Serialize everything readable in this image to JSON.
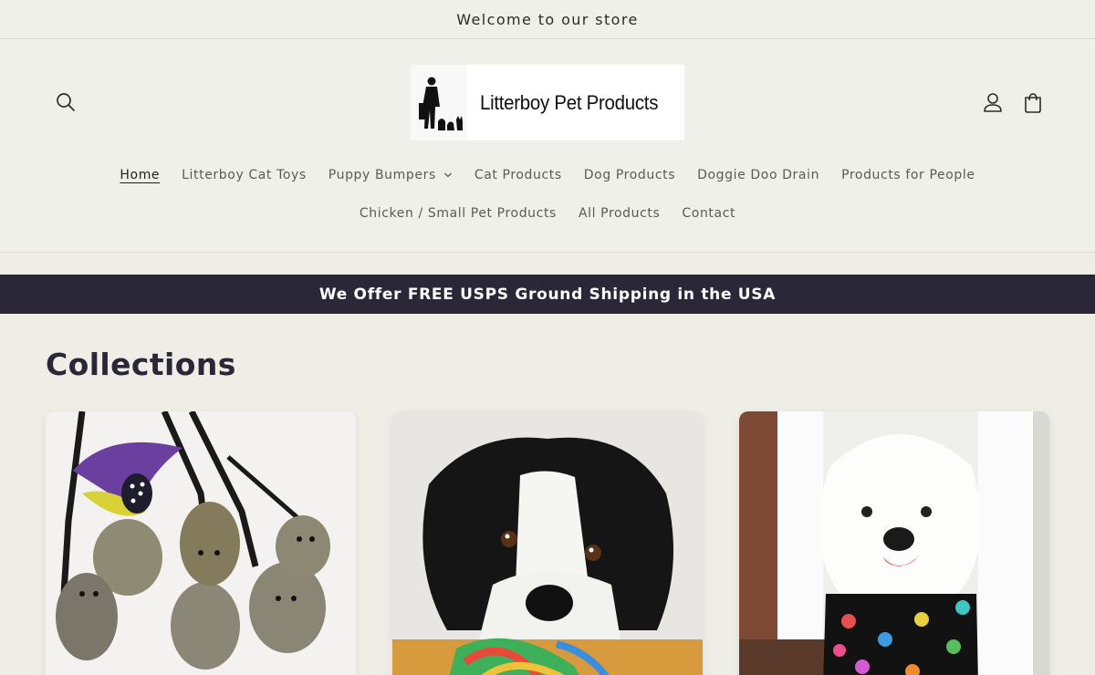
{
  "announcement": {
    "text": "Welcome to our store"
  },
  "header": {
    "logo": {
      "text": "Litterboy Pet Products"
    },
    "icons": {
      "search": "search-icon",
      "account": "account-icon",
      "cart": "cart-icon"
    }
  },
  "nav": {
    "row1": [
      {
        "label": "Home",
        "active": true
      },
      {
        "label": "Litterboy Cat Toys"
      },
      {
        "label": "Puppy Bumpers",
        "dropdown": true
      },
      {
        "label": "Cat Products"
      },
      {
        "label": "Dog Products"
      },
      {
        "label": "Doggie Doo Drain"
      },
      {
        "label": "Products for People"
      }
    ],
    "row2": [
      {
        "label": "Chicken / Small Pet Products"
      },
      {
        "label": "All Products"
      },
      {
        "label": "Contact"
      }
    ]
  },
  "promo": {
    "text": "We Offer FREE USPS Ground Shipping in the USA"
  },
  "collections": {
    "title": "Collections",
    "cards": [
      {
        "image": "cat-toy-mice-with-feathers"
      },
      {
        "image": "border-collie-with-rope-toy"
      },
      {
        "image": "white-dog-in-paw-print-bumper"
      }
    ]
  },
  "colors": {
    "background": "#efeee6",
    "header_bg": "#f0f0ea",
    "promo_bg": "#2a2838",
    "text": "#2a2838"
  }
}
